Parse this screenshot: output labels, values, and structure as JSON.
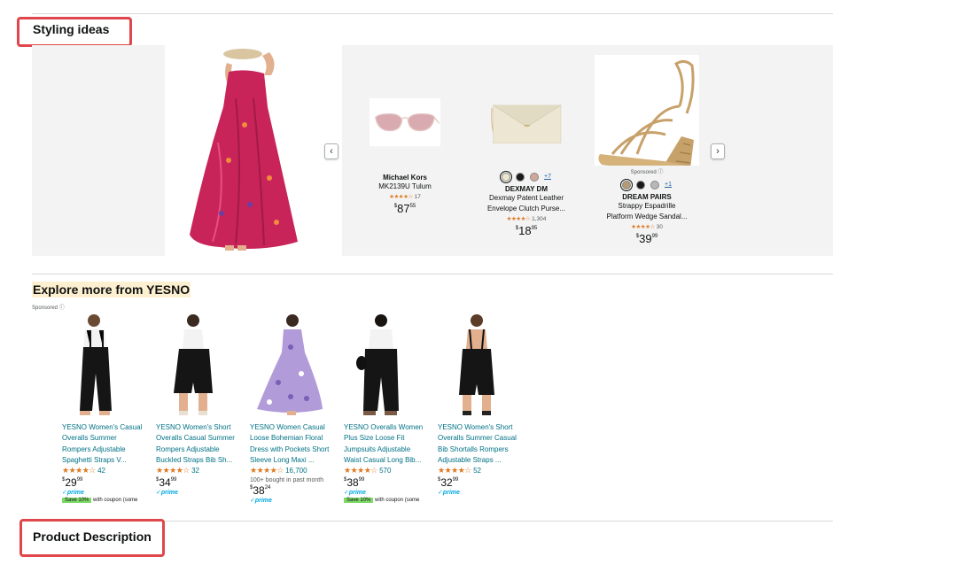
{
  "styling_ideas": {
    "title": "Styling ideas",
    "cards": [
      {
        "brand": "Michael Kors",
        "name_lines": [
          "MK2139U Tulum"
        ],
        "stars": "★★★★☆",
        "rating_count": "17",
        "price_symbol": "$",
        "price_whole": "87",
        "price_frac": "55",
        "sponsored": "",
        "swatches": [],
        "swatch_more": ""
      },
      {
        "brand": "DEXMAY DM",
        "name_lines": [
          "Dexmay Patent Leather",
          "Envelope Clutch Purse..."
        ],
        "stars": "★★★★☆",
        "rating_count": "1,304",
        "price_symbol": "$",
        "price_whole": "18",
        "price_frac": "95",
        "sponsored": "",
        "swatches": [
          "#ede6cf",
          "#1a1a1a",
          "#cfa89a"
        ],
        "swatch_more": "+7"
      },
      {
        "brand": "DREAM PAIRS",
        "name_lines": [
          "Strappy Espadrille",
          "Platform Wedge Sandal..."
        ],
        "stars": "★★★★☆",
        "rating_count": "30",
        "price_symbol": "$",
        "price_whole": "39",
        "price_frac": "99",
        "sponsored": "Sponsored ⓘ",
        "swatches": [
          "#b59a74",
          "#1a1a1a",
          "#b8b8b8"
        ],
        "swatch_more": "+1"
      }
    ],
    "prev_icon": "chevron-left-icon",
    "next_icon": "chevron-right-icon",
    "prev_glyph": "‹",
    "next_glyph": "›"
  },
  "explore": {
    "title": "Explore more from YESNO",
    "sponsored": "Sponsored ⓘ",
    "products": [
      {
        "title_lines": [
          "YESNO Women's Casual",
          "Overalls Summer",
          "Rompers Adjustable",
          "Spaghetti Straps V..."
        ],
        "stars": "★★★★☆",
        "rating_count": "42",
        "bought": "",
        "price_symbol": "$",
        "price_whole": "29",
        "price_frac": "99",
        "prime": "✓prime",
        "coupon_tag": "Save 10%",
        "coupon_text": "with coupon (some"
      },
      {
        "title_lines": [
          "YESNO Women's Short",
          "Overalls Casual Summer",
          "Rompers Adjustable",
          "Buckled Straps Bib Sh..."
        ],
        "stars": "★★★★☆",
        "rating_count": "32",
        "bought": "",
        "price_symbol": "$",
        "price_whole": "34",
        "price_frac": "99",
        "prime": "✓prime",
        "coupon_tag": "",
        "coupon_text": ""
      },
      {
        "title_lines": [
          "YESNO Women Casual",
          "Loose Bohemian Floral",
          "Dress with Pockets Short",
          "Sleeve Long Maxi ..."
        ],
        "stars": "★★★★☆",
        "rating_count": "16,700",
        "bought": "100+ bought in past month",
        "price_symbol": "$",
        "price_whole": "38",
        "price_frac": "24",
        "prime": "✓prime",
        "coupon_tag": "",
        "coupon_text": ""
      },
      {
        "title_lines": [
          "YESNO Overalls Women",
          "Plus Size Loose Fit",
          "Jumpsuits Adjustable",
          "Waist Casual Long Bib..."
        ],
        "stars": "★★★★☆",
        "rating_count": "570",
        "bought": "",
        "price_symbol": "$",
        "price_whole": "38",
        "price_frac": "99",
        "prime": "✓prime",
        "coupon_tag": "Save 10%",
        "coupon_text": "with coupon (some"
      },
      {
        "title_lines": [
          "YESNO Women's Short",
          "Overalls Summer Casual",
          "Bib Shortalls Rompers",
          "Adjustable Straps ..."
        ],
        "stars": "★★★★☆",
        "rating_count": "52",
        "bought": "",
        "price_symbol": "$",
        "price_whole": "32",
        "price_frac": "99",
        "prime": "✓prime",
        "coupon_tag": "",
        "coupon_text": ""
      }
    ]
  },
  "product_description": {
    "title": "Product Description"
  },
  "colors": {
    "highlight": "#e0474c",
    "link": "#007185",
    "star": "#de7921",
    "prime": "#00a8e1",
    "coupon": "#7fda69"
  }
}
